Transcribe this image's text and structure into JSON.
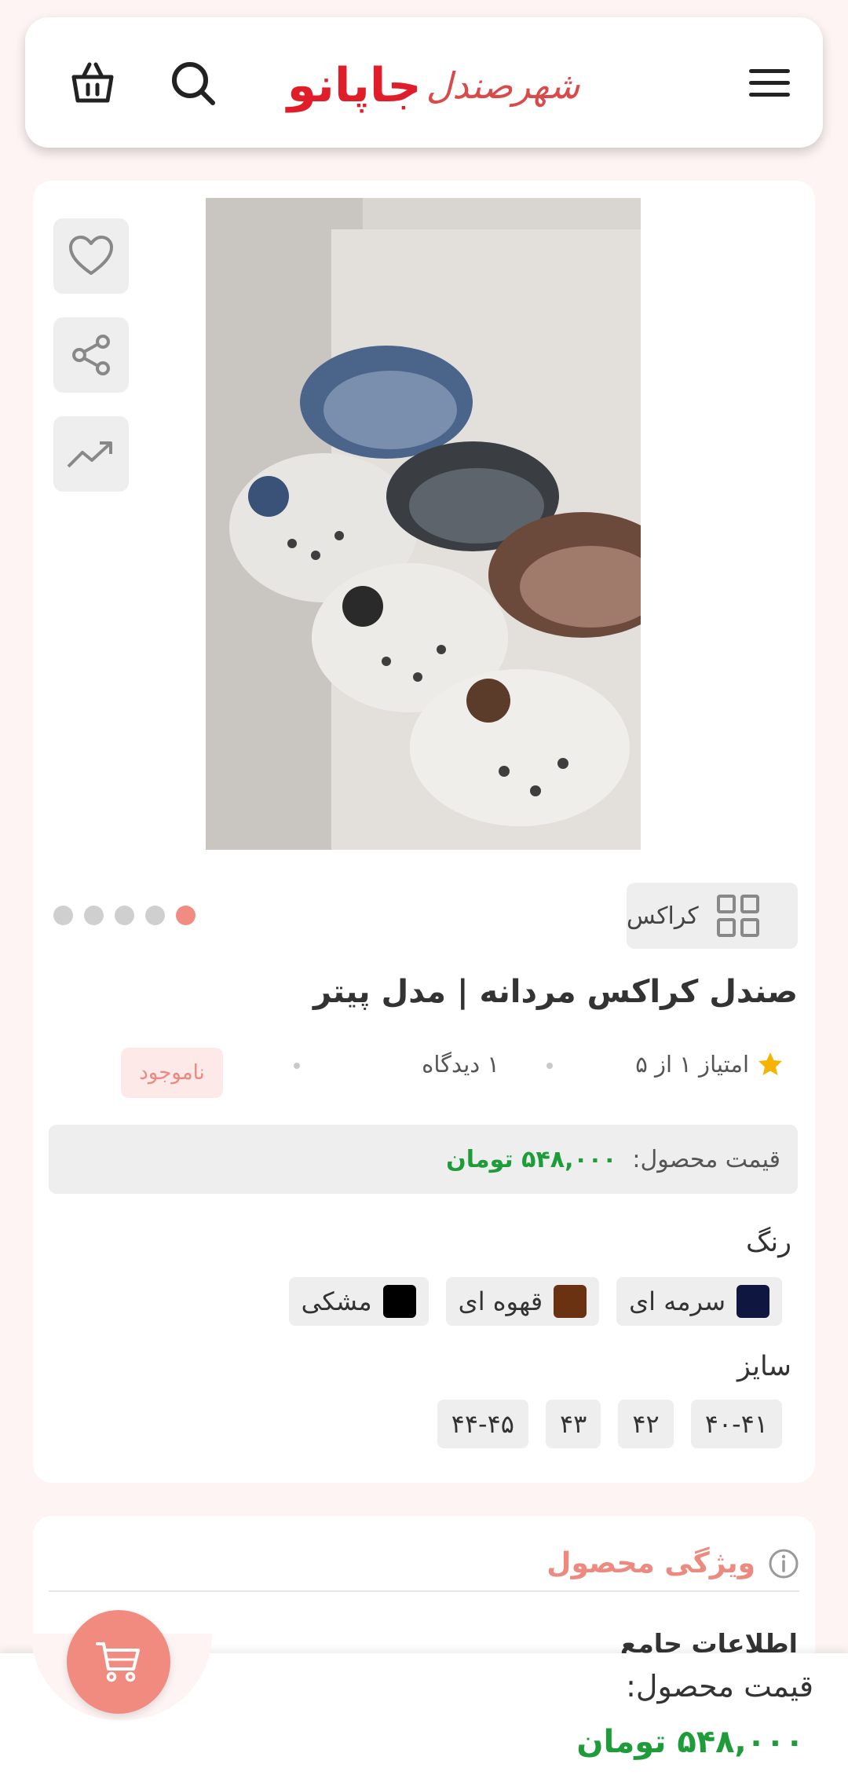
{
  "header": {
    "logo_part1": "شهرصندل",
    "logo_part2": "جاپانو"
  },
  "product": {
    "category": "کراکس",
    "title": "صندل کراکس مردانه | مدل پیتر",
    "rating_text": "امتیاز ۱ از ۵",
    "views_text": "۱ دیدگاه",
    "stock_status": "ناموجود",
    "price_label": "قیمت محصول:",
    "price_value": "۵۴۸,۰۰۰ تومان",
    "gallery_total": 5,
    "gallery_active": 1
  },
  "options": {
    "color_label": "رنگ",
    "colors": [
      {
        "name": "سرمه ای",
        "hex": "#0f1640"
      },
      {
        "name": "قهوه ای",
        "hex": "#6b3212"
      },
      {
        "name": "مشکی",
        "hex": "#000000"
      }
    ],
    "size_label": "سایز",
    "sizes": [
      "۴۰-۴۱",
      "۴۲",
      "۴۳",
      "۴۴-۴۵"
    ]
  },
  "specs": {
    "title": "ویژگی محصول",
    "first_section": "اطلاعات جامع"
  },
  "bottom_bar": {
    "price_label": "قیمت محصول:",
    "price_value": "۵۴۸,۰۰۰ تومان"
  },
  "colors": {
    "accent": "#f28b7f",
    "price_green": "#1e9c3a",
    "logo_red": "#e01e2a"
  },
  "icons": [
    "menu-icon",
    "search-icon",
    "basket-icon",
    "heart-icon",
    "share-icon",
    "trend-icon",
    "grid-icon",
    "star-icon",
    "info-icon",
    "cart-icon"
  ]
}
